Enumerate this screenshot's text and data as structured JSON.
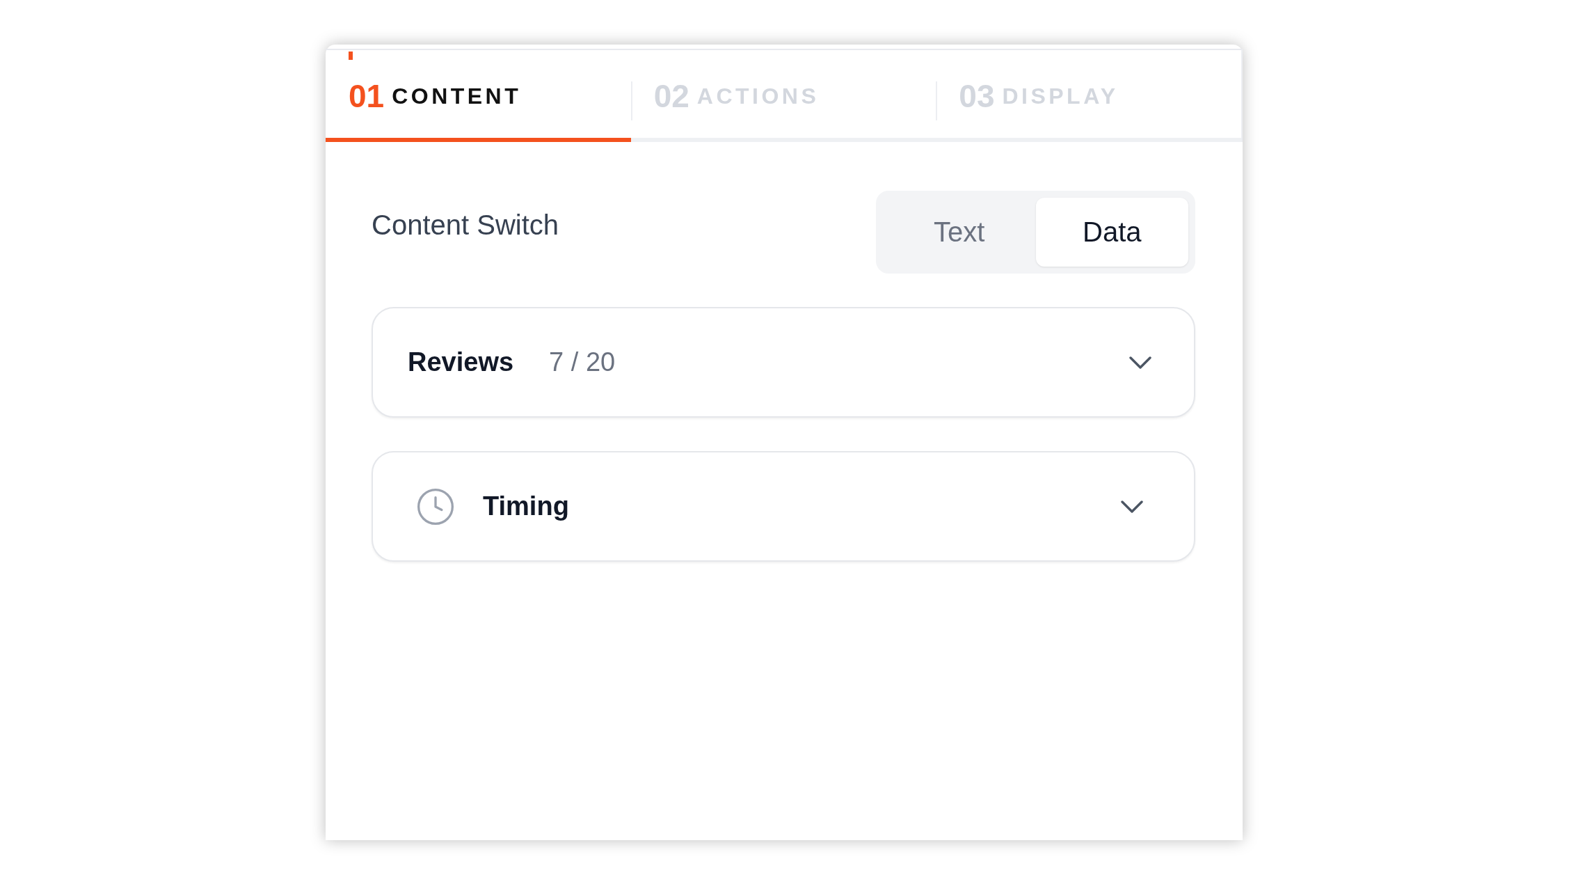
{
  "tabs": [
    {
      "number": "01",
      "label": "CONTENT",
      "selected": true
    },
    {
      "number": "02",
      "label": "ACTIONS",
      "selected": false
    },
    {
      "number": "03",
      "label": "DISPLAY",
      "selected": false
    }
  ],
  "content_switch": {
    "label": "Content Switch",
    "options": [
      {
        "label": "Text",
        "selected": false
      },
      {
        "label": "Data",
        "selected": true
      }
    ]
  },
  "sections": [
    {
      "kind": "count",
      "title": "Reviews",
      "count": "7 / 20",
      "expanded": false
    },
    {
      "kind": "icon",
      "title": "Timing",
      "expanded": false
    }
  ]
}
